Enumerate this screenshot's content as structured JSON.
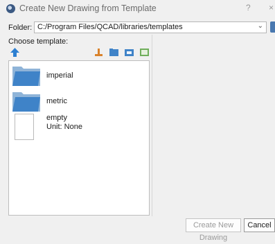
{
  "dialog": {
    "title": "Create New Drawing from Template",
    "help": "?",
    "close": "×"
  },
  "folder": {
    "label": "Folder:",
    "value": "C:/Program Files/QCAD/libraries/templates"
  },
  "choose_label": "Choose template:",
  "templates": [
    {
      "name": "imperial",
      "type": "folder"
    },
    {
      "name": "metric",
      "type": "folder"
    },
    {
      "name": "empty",
      "unit": "Unit: None",
      "type": "file"
    }
  ],
  "buttons": {
    "create": "Create New Drawing",
    "cancel": "Cancel"
  },
  "colors": {
    "folder_blue": "#3f83c8",
    "up_arrow": "#2c7fd1"
  }
}
